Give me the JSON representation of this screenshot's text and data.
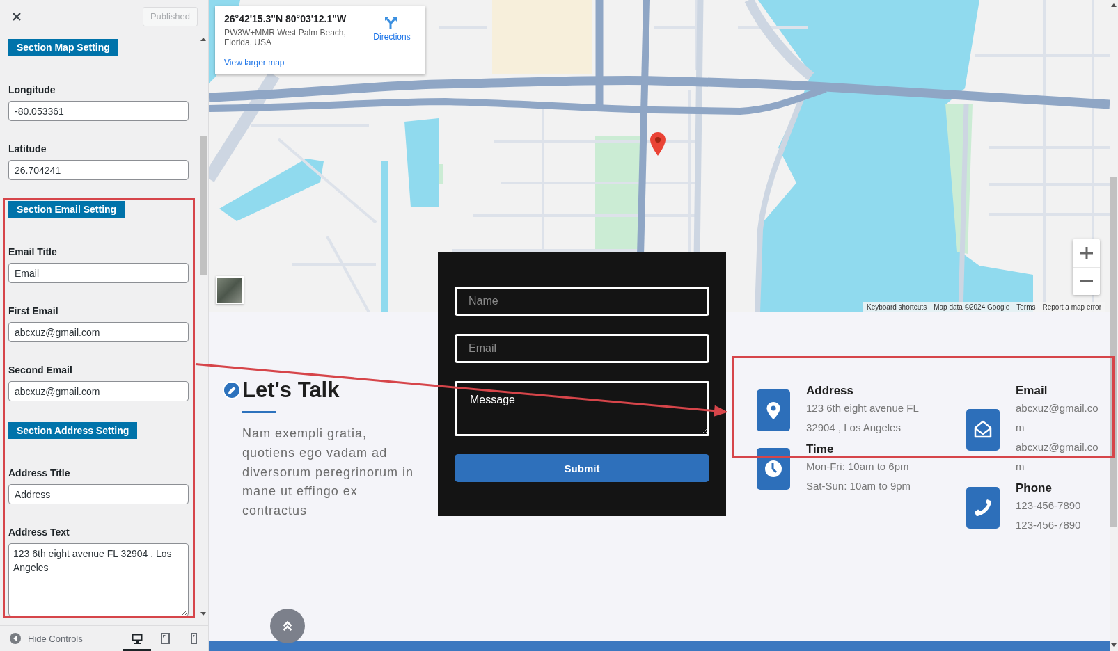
{
  "customizer": {
    "publish_button": {
      "label": "Published",
      "disabled": true
    },
    "controls": [
      {
        "kind": "section",
        "label": "Section Map Setting"
      },
      {
        "kind": "text",
        "label": "Longitude",
        "value": "-80.053361"
      },
      {
        "kind": "text",
        "label": "Latitude",
        "value": "26.704241"
      },
      {
        "kind": "section",
        "label": "Section Email Setting"
      },
      {
        "kind": "text",
        "label": "Email Title",
        "value": "Email"
      },
      {
        "kind": "text",
        "label": "First Email",
        "value": "abcxuz@gmail.com"
      },
      {
        "kind": "text",
        "label": "Second Email",
        "value": "abcxuz@gmail.com"
      },
      {
        "kind": "section",
        "label": "Section Address Setting"
      },
      {
        "kind": "text",
        "label": "Address Title",
        "value": "Address"
      },
      {
        "kind": "textarea",
        "label": "Address Text",
        "value": "123 6th eight avenue FL 32904 , Los Angeles"
      }
    ],
    "footer": {
      "toggle_label": "Hide Controls",
      "devices": [
        {
          "kind": "desktop",
          "selected": true
        },
        {
          "kind": "tablet",
          "selected": false
        },
        {
          "kind": "mobile",
          "selected": false
        }
      ]
    }
  },
  "map": {
    "place_card": {
      "coordinates": "26°42'15.3\"N 80°03'12.1\"W",
      "address": "PW3W+MMR West Palm Beach, Florida, USA",
      "directions": "Directions",
      "larger_map_link": "View larger map"
    },
    "attribution": [
      "Keyboard shortcuts",
      "Map data ©2024 Google",
      "Terms",
      "Report a map error"
    ]
  },
  "contact": {
    "heading": "Let's Talk",
    "intro": "Nam exempli gratia, quotiens ego vadam ad diversorum peregrinorum in mane ut effingo ex contractus",
    "form": {
      "fields": [
        {
          "kind": "input",
          "placeholder": "Name"
        },
        {
          "kind": "input",
          "placeholder": "Email"
        },
        {
          "kind": "textarea",
          "placeholder": "Message"
        }
      ],
      "submit": "Submit"
    },
    "info_columns": [
      {
        "items": [
          {
            "kind": "address",
            "title": "Address",
            "lines": [
              "123 6th eight avenue FL 32904 , Los Angeles"
            ]
          },
          {
            "kind": "time",
            "title": "Time",
            "lines": [
              "Mon-Fri: 10am to 6pm",
              "Sat-Sun: 10am to 9pm"
            ]
          }
        ]
      },
      {
        "items": [
          {
            "kind": "email",
            "title": "Email",
            "lines": [
              "abcxuz@gmail.com",
              "abcxuz@gmail.com"
            ]
          },
          {
            "kind": "phone",
            "title": "Phone",
            "lines": [
              "123-456-7890",
              "123-456-7890"
            ]
          }
        ]
      }
    ]
  }
}
